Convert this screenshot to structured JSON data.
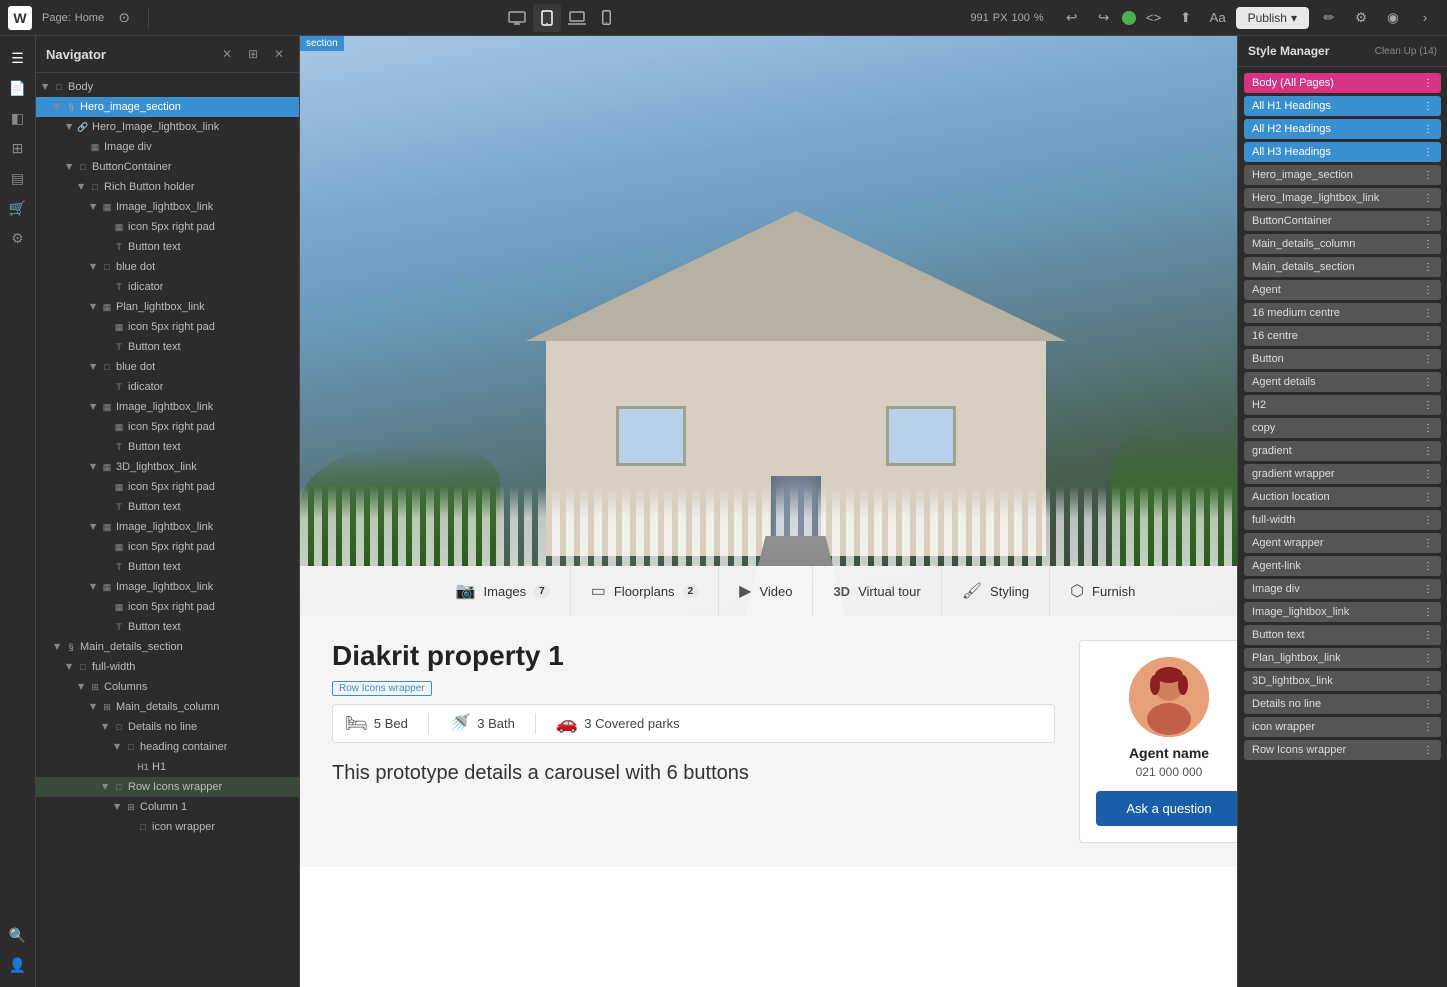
{
  "toolbar": {
    "logo": "W",
    "page_label": "Page:",
    "page_name": "Home",
    "width": "991",
    "width_unit": "PX",
    "zoom": "100",
    "zoom_unit": "%",
    "publish_label": "Publish",
    "canvas_section_label": "section"
  },
  "navigator": {
    "title": "Navigator",
    "tree": [
      {
        "id": "body",
        "label": "Body",
        "level": 0,
        "icon": "box",
        "expanded": true,
        "type": "group"
      },
      {
        "id": "hero_image_section",
        "label": "Hero_image_section",
        "level": 1,
        "icon": "section",
        "expanded": true,
        "selected": true,
        "type": "section"
      },
      {
        "id": "hero_image_lightbox_link",
        "label": "Hero_Image_lightbox_link",
        "level": 2,
        "icon": "link",
        "expanded": true,
        "type": "link"
      },
      {
        "id": "image_div",
        "label": "Image div",
        "level": 3,
        "icon": "image",
        "type": "image"
      },
      {
        "id": "button_container",
        "label": "ButtonContainer",
        "level": 2,
        "icon": "box",
        "expanded": true,
        "type": "group"
      },
      {
        "id": "rich_button_holder",
        "label": "Rich Button holder",
        "level": 3,
        "icon": "box",
        "expanded": false,
        "type": "group"
      },
      {
        "id": "image_lightbox_link1",
        "label": "Image_lightbox_link",
        "level": 4,
        "icon": "link",
        "expanded": true,
        "type": "link"
      },
      {
        "id": "icon_5px_right_pad1",
        "label": "icon 5px right pad",
        "level": 5,
        "icon": "image",
        "type": "image"
      },
      {
        "id": "button_text1",
        "label": "Button text",
        "level": 5,
        "icon": "text",
        "type": "text"
      },
      {
        "id": "blue_dot1",
        "label": "blue dot",
        "level": 4,
        "icon": "box",
        "expanded": true,
        "type": "group"
      },
      {
        "id": "idicator1",
        "label": "idicator",
        "level": 5,
        "icon": "text",
        "type": "text"
      },
      {
        "id": "plan_lightbox_link",
        "label": "Plan_lightbox_link",
        "level": 4,
        "icon": "link",
        "expanded": true,
        "type": "link"
      },
      {
        "id": "icon_5px_right_pad2",
        "label": "icon 5px right pad",
        "level": 5,
        "icon": "image",
        "type": "image"
      },
      {
        "id": "button_text2",
        "label": "Button text",
        "level": 5,
        "icon": "text",
        "type": "text"
      },
      {
        "id": "blue_dot2",
        "label": "blue dot",
        "level": 4,
        "icon": "box",
        "expanded": true,
        "type": "group"
      },
      {
        "id": "idicator2",
        "label": "idicator",
        "level": 5,
        "icon": "text",
        "type": "text"
      },
      {
        "id": "image_lightbox_link2",
        "label": "Image_lightbox_link",
        "level": 4,
        "icon": "link",
        "expanded": true,
        "type": "link"
      },
      {
        "id": "icon_5px_right_pad3",
        "label": "icon 5px right pad",
        "level": 5,
        "icon": "image",
        "type": "image"
      },
      {
        "id": "button_text3",
        "label": "Button text",
        "level": 5,
        "icon": "text",
        "type": "text"
      },
      {
        "id": "3d_lightbox_link",
        "label": "3D_lightbox_link",
        "level": 4,
        "icon": "link",
        "expanded": true,
        "type": "link"
      },
      {
        "id": "icon_5px_right_pad4",
        "label": "icon 5px right pad",
        "level": 5,
        "icon": "image",
        "type": "image"
      },
      {
        "id": "button_text4",
        "label": "Button text",
        "level": 5,
        "icon": "text",
        "type": "text"
      },
      {
        "id": "image_lightbox_link3",
        "label": "Image_lightbox_link",
        "level": 4,
        "icon": "link",
        "expanded": true,
        "type": "link"
      },
      {
        "id": "icon_5px_right_pad5",
        "label": "icon 5px right pad",
        "level": 5,
        "icon": "image",
        "type": "image"
      },
      {
        "id": "button_text5",
        "label": "Button text",
        "level": 5,
        "icon": "text",
        "type": "text"
      },
      {
        "id": "image_lightbox_link4",
        "label": "Image_lightbox_link",
        "level": 4,
        "icon": "link",
        "expanded": true,
        "type": "link"
      },
      {
        "id": "icon_5px_right_pad6",
        "label": "icon 5px right pad",
        "level": 5,
        "icon": "image",
        "type": "image"
      },
      {
        "id": "button_text6",
        "label": "Button text",
        "level": 5,
        "icon": "text",
        "type": "text"
      },
      {
        "id": "main_details_section",
        "label": "Main_details_section",
        "level": 1,
        "icon": "section",
        "expanded": true,
        "type": "section"
      },
      {
        "id": "full_width",
        "label": "full-width",
        "level": 2,
        "icon": "box",
        "expanded": true,
        "type": "group"
      },
      {
        "id": "columns",
        "label": "Columns",
        "level": 3,
        "icon": "columns",
        "expanded": true,
        "type": "group"
      },
      {
        "id": "main_details_column",
        "label": "Main_details_column",
        "level": 4,
        "icon": "columns",
        "expanded": true,
        "type": "group"
      },
      {
        "id": "details_no_line",
        "label": "Details no line",
        "level": 5,
        "icon": "box",
        "expanded": true,
        "type": "group"
      },
      {
        "id": "heading_container",
        "label": "heading container",
        "level": 6,
        "icon": "box",
        "expanded": true,
        "type": "group"
      },
      {
        "id": "h1",
        "label": "H1",
        "level": 7,
        "icon": "text",
        "type": "text"
      },
      {
        "id": "row_icons_wrapper",
        "label": "Row Icons wrapper",
        "level": 5,
        "icon": "box",
        "expanded": true,
        "type": "group"
      },
      {
        "id": "column1",
        "label": "Column 1",
        "level": 6,
        "icon": "columns",
        "expanded": true,
        "type": "group"
      },
      {
        "id": "icon_wrapper",
        "label": "icon wrapper",
        "level": 7,
        "icon": "box",
        "type": "group"
      }
    ]
  },
  "canvas": {
    "section_label": "section",
    "hero": {
      "button_bar": [
        {
          "icon": "📷",
          "label": "Images",
          "badge": "7"
        },
        {
          "icon": "▭",
          "label": "Floorplans",
          "badge": "2"
        },
        {
          "icon": "▶",
          "label": "Video",
          "badge": ""
        },
        {
          "icon": "3D",
          "label": "Virtual tour",
          "badge": ""
        },
        {
          "icon": "🖌",
          "label": "Styling",
          "badge": ""
        },
        {
          "icon": "⬡",
          "label": "Furnish",
          "badge": ""
        }
      ]
    },
    "main": {
      "property_title": "Diakrit property 1",
      "row_icons_label": "Row Icons wrapper",
      "features": [
        {
          "icon": "🛏",
          "label": "5 Bed"
        },
        {
          "icon": "🚿",
          "label": "3 Bath"
        },
        {
          "icon": "🚗",
          "label": "3 Covered parks"
        }
      ],
      "description": "This prototype details a carousel with 6 buttons",
      "agent": {
        "name": "Agent name",
        "phone": "021 000 000",
        "cta": "Ask a question"
      }
    }
  },
  "style_manager": {
    "title": "Style Manager",
    "cleanup_label": "Clean Up (14)",
    "tags": [
      {
        "label": "Body (All Pages)",
        "color": "pink"
      },
      {
        "label": "All H1 Headings",
        "color": "blue"
      },
      {
        "label": "All H2 Headings",
        "color": "blue"
      },
      {
        "label": "All H3 Headings",
        "color": "blue"
      },
      {
        "label": "Hero_image_section",
        "color": "gray"
      },
      {
        "label": "Hero_Image_lightbox_link",
        "color": "gray"
      },
      {
        "label": "ButtonContainer",
        "color": "gray"
      },
      {
        "label": "Main_details_column",
        "color": "gray"
      },
      {
        "label": "Main_details_section",
        "color": "gray"
      },
      {
        "label": "Agent",
        "color": "gray"
      },
      {
        "label": "16 medium centre",
        "color": "gray"
      },
      {
        "label": "16 centre",
        "color": "gray"
      },
      {
        "label": "Button",
        "color": "gray"
      },
      {
        "label": "Agent details",
        "color": "gray"
      },
      {
        "label": "H2",
        "color": "gray"
      },
      {
        "label": "copy",
        "color": "gray"
      },
      {
        "label": "gradient",
        "color": "gray"
      },
      {
        "label": "gradient wrapper",
        "color": "gray"
      },
      {
        "label": "Auction location",
        "color": "gray"
      },
      {
        "label": "full-width",
        "color": "gray"
      },
      {
        "label": "Agent wrapper",
        "color": "gray"
      },
      {
        "label": "Agent-link",
        "color": "gray"
      },
      {
        "label": "Image div",
        "color": "gray"
      },
      {
        "label": "Image_lightbox_link",
        "color": "gray"
      },
      {
        "label": "Button text",
        "color": "gray"
      },
      {
        "label": "Plan_lightbox_link",
        "color": "gray"
      },
      {
        "label": "3D_lightbox_link",
        "color": "gray"
      },
      {
        "label": "Details no line",
        "color": "gray"
      },
      {
        "label": "icon wrapper",
        "color": "gray"
      },
      {
        "label": "Row Icons wrapper",
        "color": "gray"
      }
    ]
  }
}
